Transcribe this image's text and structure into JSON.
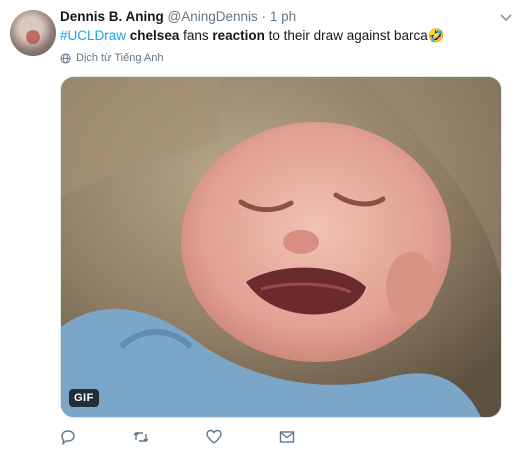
{
  "tweet": {
    "display_name": "Dennis B. Aning",
    "handle": "@AningDennis",
    "separator": "·",
    "time": "1 ph",
    "text": {
      "hashtag": "#UCLDraw",
      "space1": " ",
      "word1_bold": "chelsea",
      "plain1": " fans ",
      "word2_bold": "reaction",
      "plain2": " to their draw against barca",
      "emoji": "🤣"
    },
    "translate_label": "Dịch từ Tiếng Anh",
    "media_badge": "GIF"
  },
  "colors": {
    "link": "#1da1f2",
    "muted": "#657786",
    "text": "#14171a"
  },
  "icons": [
    "caret-down-icon",
    "globe-icon",
    "reply-icon",
    "retweet-icon",
    "like-icon",
    "direct-message-icon"
  ]
}
